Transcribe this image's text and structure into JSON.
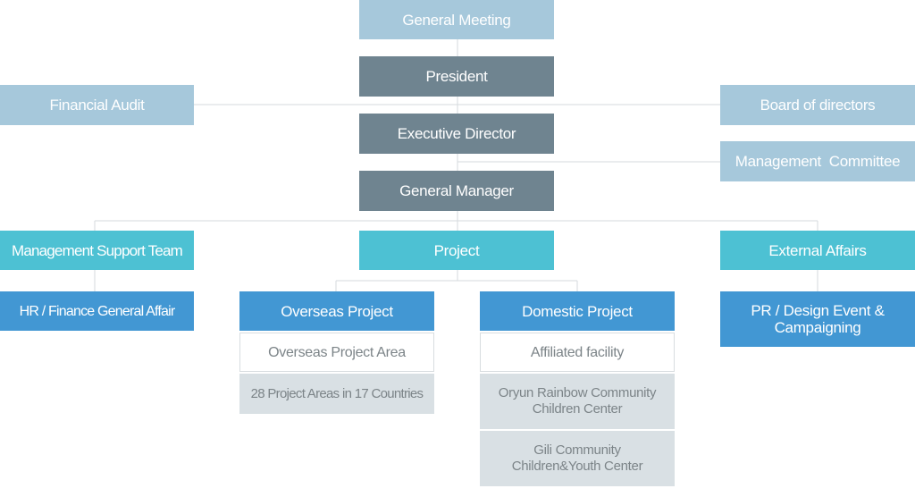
{
  "nodes": {
    "general_meeting": "General Meeting",
    "president": "President",
    "financial_audit": "Financial Audit",
    "board_of_directors": "Board of directors",
    "executive_director": "Executive Director",
    "management_committee": "Management  Committee",
    "general_manager": "General Manager",
    "management_support_team": "Management Support Team",
    "project": "Project",
    "external_affairs": "External Affairs",
    "hr_finance": "HR / Finance General Affair",
    "overseas_project": "Overseas Project",
    "domestic_project": "Domestic Project",
    "pr_design_line1": "PR / Design Event &",
    "pr_design_line2": "Campaigning",
    "overseas_area": "Overseas Project Area",
    "overseas_count": "28 Project Areas in 17 Countries",
    "affiliated_facility": "Affiliated facility",
    "oryun_line1": "Oryun Rainbow Community",
    "oryun_line2": "Children Center",
    "gili_line1": "Gili Community",
    "gili_line2": "Children&Youth Center"
  },
  "colors": {
    "light": "#a6c8db",
    "dark": "#6f8490",
    "teal": "#4dc1d3",
    "blue": "#4297d3",
    "grey": "#d9e0e4",
    "line": "#d5dadd"
  }
}
